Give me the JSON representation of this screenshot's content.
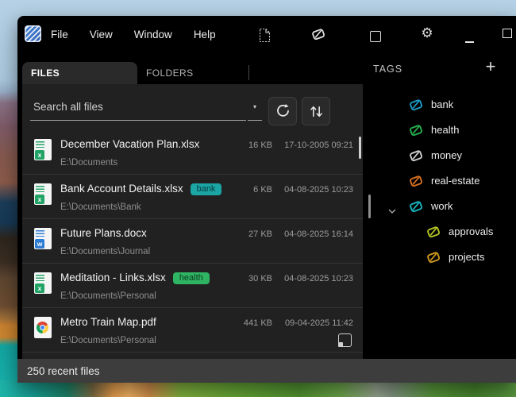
{
  "window": {
    "menu": [
      "File",
      "View",
      "Window",
      "Help"
    ]
  },
  "tabs": [
    {
      "label": "FILES",
      "active": true
    },
    {
      "label": "FOLDERS",
      "active": false
    }
  ],
  "search": {
    "placeholder": "Search all files"
  },
  "files": [
    {
      "name": "December Vacation Plan.xlsx",
      "type": "xlsx",
      "badge": null,
      "size": "16 KB",
      "modified": "17-10-2005 09:21",
      "path": "E:\\Documents"
    },
    {
      "name": "Bank Account Details.xlsx",
      "type": "xlsx",
      "badge": "bank",
      "size": "6 KB",
      "modified": "04-08-2025 10:23",
      "path": "E:\\Documents\\Bank"
    },
    {
      "name": "Future Plans.docx",
      "type": "docx",
      "badge": null,
      "size": "27 KB",
      "modified": "04-08-2025 16:14",
      "path": "E:\\Documents\\Journal"
    },
    {
      "name": "Meditation - Links.xlsx",
      "type": "xlsx",
      "badge": "health",
      "size": "30 KB",
      "modified": "04-08-2025 10:23",
      "path": "E:\\Documents\\Personal"
    },
    {
      "name": "Metro Train Map.pdf",
      "type": "pdf-chrome",
      "badge": null,
      "size": "441 KB",
      "modified": "09-04-2025 11:42",
      "path": "E:\\Documents\\Personal"
    }
  ],
  "badges": {
    "bank": {
      "bg": "#1ca5a5",
      "fg": "#073a3e"
    },
    "health": {
      "bg": "#2fb463",
      "fg": "#0c3d1f"
    }
  },
  "file_icons": {
    "xlsx": {
      "color": "#21a366",
      "letter": "x"
    },
    "docx": {
      "color": "#2b7cd3",
      "letter": "w"
    },
    "pdf-chrome": {
      "chrome": true
    }
  },
  "tags": {
    "header": "TAGS",
    "items": [
      {
        "label": "bank",
        "color": "#1b9cc6",
        "indent": 0,
        "expanded": false
      },
      {
        "label": "health",
        "color": "#27b14e",
        "indent": 0,
        "expanded": false
      },
      {
        "label": "money",
        "color": "#cfcfcf",
        "indent": 0,
        "expanded": false
      },
      {
        "label": "real-estate",
        "color": "#d9701f",
        "indent": 0,
        "expanded": false
      },
      {
        "label": "work",
        "color": "#17b6c4",
        "indent": 0,
        "expanded": true
      },
      {
        "label": "approvals",
        "color": "#b5c623",
        "indent": 1,
        "expanded": false
      },
      {
        "label": "projects",
        "color": "#d1991d",
        "indent": 1,
        "expanded": false
      }
    ]
  },
  "status_bar": {
    "text": "250 recent files"
  },
  "icons": {
    "gear": "⚙",
    "plus": "+",
    "dropdown_arrow": "▾"
  },
  "colors": {
    "window_bg": "#000000",
    "panel_bg": "#212121",
    "tab_active_bg": "#2a2a2a",
    "statusbar_bg": "#3d3d3d",
    "accent_teal": "#1ca5a5"
  }
}
